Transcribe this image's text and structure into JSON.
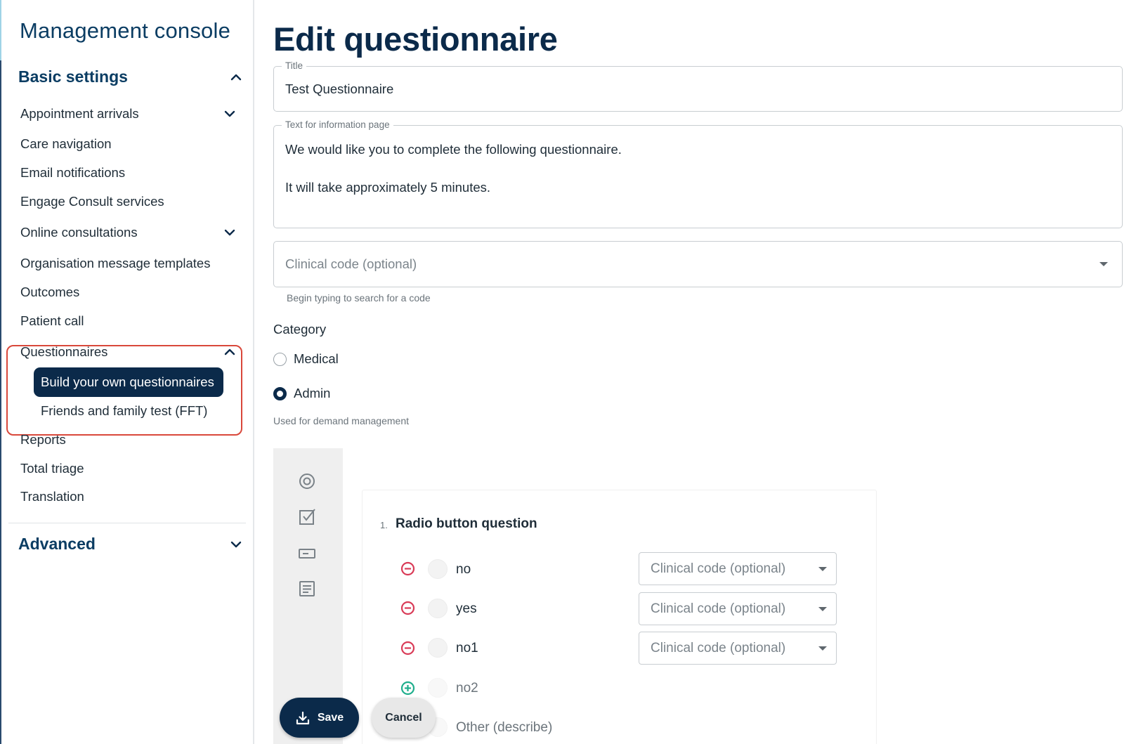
{
  "sidebar": {
    "title": "Management console",
    "basic_settings": "Basic settings",
    "items": [
      {
        "label": "Appointment arrivals"
      },
      {
        "label": "Care navigation"
      },
      {
        "label": "Email notifications"
      },
      {
        "label": "Engage Consult services"
      },
      {
        "label": "Online consultations"
      },
      {
        "label": "Organisation message templates"
      },
      {
        "label": "Outcomes"
      },
      {
        "label": "Patient call"
      },
      {
        "label": "Questionnaires"
      },
      {
        "label": "Reports"
      },
      {
        "label": "Total triage"
      },
      {
        "label": "Translation"
      }
    ],
    "questionnaires_sub": [
      {
        "label": "Build your own questionnaires",
        "active": true
      },
      {
        "label": "Friends and family test (FFT)",
        "active": false
      }
    ],
    "advanced": "Advanced"
  },
  "main": {
    "page_title": "Edit questionnaire",
    "title_field": {
      "legend": "Title",
      "value": "Test Questionnaire"
    },
    "info_field": {
      "legend": "Text for information page",
      "line1": "We would like you to complete the following questionnaire.",
      "line2": "It will take approximately 5 minutes."
    },
    "clinical_code": {
      "placeholder": "Clinical code (optional)",
      "helper": "Begin typing to search for a code"
    },
    "category": {
      "label": "Category",
      "options": [
        {
          "label": "Medical",
          "selected": false
        },
        {
          "label": "Admin",
          "selected": true
        }
      ],
      "helper": "Used for demand management"
    },
    "toolbox_icons": [
      "radio-question-icon",
      "checkbox-question-icon",
      "text-input-question-icon",
      "text-area-question-icon"
    ],
    "question": {
      "number": "1.",
      "title": "Radio button question",
      "options": [
        {
          "label": "no",
          "code_placeholder": "Clinical code (optional)"
        },
        {
          "label": "yes",
          "code_placeholder": "Clinical code (optional)"
        },
        {
          "label": "no1",
          "code_placeholder": "Clinical code (optional)"
        }
      ],
      "add_option_label": "no2",
      "other_label": "Other (describe)"
    },
    "actions": {
      "save": "Save",
      "cancel": "Cancel"
    }
  },
  "colors": {
    "primary": "#0b2a4a",
    "highlight": "#d9483b",
    "remove": "#d93b57",
    "add": "#1fae8c"
  }
}
